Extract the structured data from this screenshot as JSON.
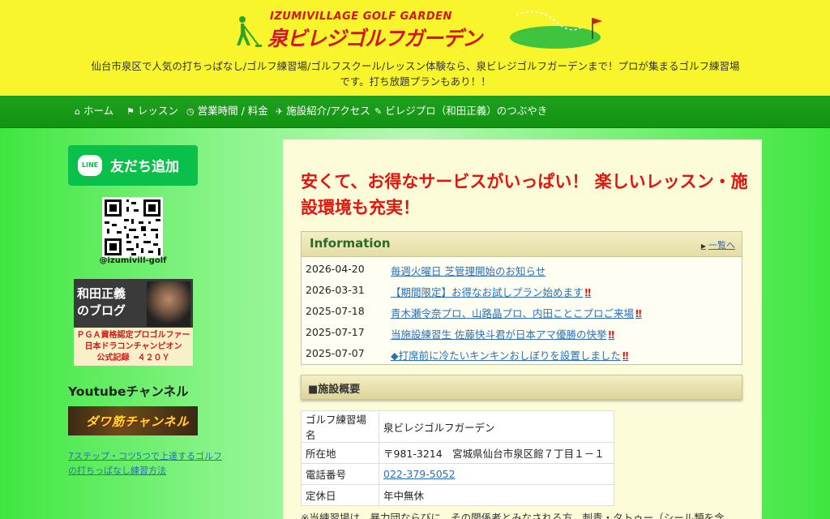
{
  "header": {
    "logo_sub": "IZUMIVILLAGE GOLF GARDEN",
    "logo_main": "泉ビレジゴルフガーデン",
    "tagline": "仙台市泉区で人気の打ちっぱなし/ゴルフ練習場/ゴルフスクール/レッスン体験なら、泉ビレジゴルフガーデンまで！プロが集まるゴルフ練習場です。打ち放題プランもあり！！"
  },
  "nav": {
    "items": [
      {
        "label": "ホーム",
        "icon": "home-icon",
        "glyph": "⌂"
      },
      {
        "label": "レッスン",
        "icon": "flag-icon",
        "glyph": "⚑"
      },
      {
        "label": "営業時間 / 料金",
        "icon": "clock-icon",
        "glyph": "◷"
      },
      {
        "label": "施設紹介/アクセス",
        "icon": "plane-icon",
        "glyph": "✈"
      },
      {
        "label": "ビレジプロ（和田正義）のつぶやき",
        "icon": "pencil-icon",
        "glyph": "✎"
      }
    ]
  },
  "sidebar": {
    "line_button": "友だち追加",
    "line_logo": "LINE",
    "qr_label": "@izumivill-golf",
    "blog_title_1": "和田正義",
    "blog_title_2": "のブログ",
    "blog_caption_1": "ＰＧＡ資格認定プロゴルファー",
    "blog_caption_2": "日本ドラコンチャンピオン",
    "blog_caption_3": "公式記録　４２０Ｙ",
    "youtube_title": "Youtubeチャンネル",
    "youtube_banner": "ダワ筋チャンネル",
    "youtube_link": "7ステップ・コツ5つで上達するゴルフの打ちっぱなし練習方法"
  },
  "main": {
    "headline": "安くて、お得なサービスがいっぱい！ 楽しいレッスン・施設環境も充実！",
    "info": {
      "title": "Information",
      "more": "一覧へ",
      "items": [
        {
          "date": "2026-04-20",
          "text": "毎週火曜日 芝管理開始のお知らせ",
          "mark": ""
        },
        {
          "date": "2026-03-31",
          "text": "【期間限定】お得なお試しプラン始めます",
          "mark": "‼"
        },
        {
          "date": "2025-07-18",
          "text": "青木瀬令奈プロ、山路晶プロ、内田ことこプロご来場",
          "mark": "‼"
        },
        {
          "date": "2025-07-17",
          "text": "当施設練習生 佐藤快斗君が日本アマ優勝の快挙",
          "mark": "‼"
        },
        {
          "date": "2025-07-07",
          "text": "◆打席前に冷たいキンキンおしぼりを設置しました",
          "mark": "‼"
        }
      ]
    },
    "facility": {
      "title": "■施設概要",
      "rows": [
        {
          "key": "ゴルフ練習場名",
          "value": "泉ビレジゴルフガーデン"
        },
        {
          "key": "所在地",
          "value": "〒981-3214　宮城県仙台市泉区館７丁目１－１"
        },
        {
          "key": "電話番号",
          "value": "022-379-5052"
        },
        {
          "key": "定休日",
          "value": "年中無休"
        }
      ]
    },
    "notice": "※当練習場は、暴力団ならびに、その関係者とみなされる方、刺青・タトゥー（シール類を含"
  },
  "colors": {
    "header_bg": "#f9f52d",
    "nav_bg": "#1a9a1a",
    "accent_red": "#e3140f",
    "link_blue": "#2a6fb8",
    "line_green": "#0bc04a"
  }
}
